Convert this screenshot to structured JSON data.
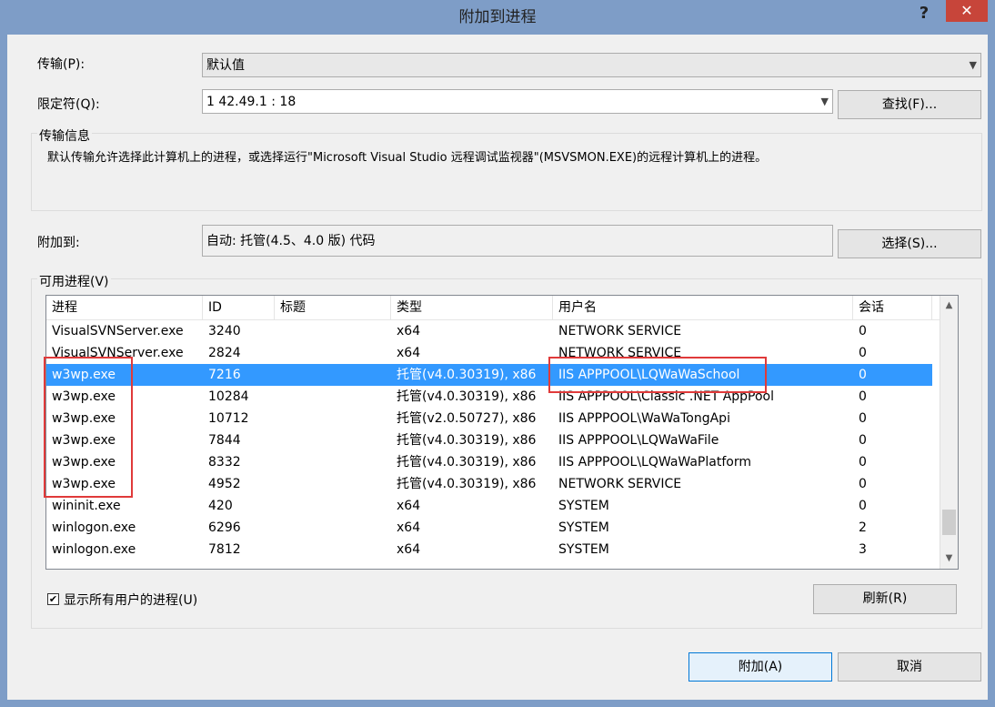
{
  "window": {
    "title": "附加到进程",
    "help_glyph": "?",
    "close_glyph": "✕"
  },
  "transport": {
    "label": "传输(P):",
    "value": "默认值"
  },
  "qualifier": {
    "label": "限定符(Q):",
    "value": "1  42.49.1 : 18",
    "find_button": "查找(F)..."
  },
  "transport_info": {
    "title": "传输信息",
    "text": "默认传输允许选择此计算机上的进程，或选择运行\"Microsoft Visual Studio 远程调试监视器\"(MSVSMON.EXE)的远程计算机上的进程。"
  },
  "attach_to": {
    "label": "附加到:",
    "value": "自动: 托管(4.5、4.0 版) 代码",
    "select_button": "选择(S)..."
  },
  "processes": {
    "group_title": "可用进程(V)",
    "columns": [
      "进程",
      "ID",
      "标题",
      "类型",
      "用户名",
      "会话"
    ],
    "rows": [
      {
        "name": "VisualSVNServer.exe",
        "id": "3240",
        "title": "",
        "type": "x64",
        "user": "NETWORK SERVICE",
        "session": "0"
      },
      {
        "name": "VisualSVNServer.exe",
        "id": "2824",
        "title": "",
        "type": "x64",
        "user": "NETWORK SERVICE",
        "session": "0"
      },
      {
        "name": "w3wp.exe",
        "id": "7216",
        "title": "",
        "type": "托管(v4.0.30319), x86",
        "user": "IIS APPPOOL\\LQWaWaSchool",
        "session": "0"
      },
      {
        "name": "w3wp.exe",
        "id": "10284",
        "title": "",
        "type": "托管(v4.0.30319), x86",
        "user": "IIS APPPOOL\\Classic .NET AppPool",
        "session": "0"
      },
      {
        "name": "w3wp.exe",
        "id": "10712",
        "title": "",
        "type": "托管(v2.0.50727), x86",
        "user": "IIS APPPOOL\\WaWaTongApi",
        "session": "0"
      },
      {
        "name": "w3wp.exe",
        "id": "7844",
        "title": "",
        "type": "托管(v4.0.30319), x86",
        "user": "IIS APPPOOL\\LQWaWaFile",
        "session": "0"
      },
      {
        "name": "w3wp.exe",
        "id": "8332",
        "title": "",
        "type": "托管(v4.0.30319), x86",
        "user": "IIS APPPOOL\\LQWaWaPlatform",
        "session": "0"
      },
      {
        "name": "w3wp.exe",
        "id": "4952",
        "title": "",
        "type": "托管(v4.0.30319), x86",
        "user": "NETWORK SERVICE",
        "session": "0"
      },
      {
        "name": "wininit.exe",
        "id": "420",
        "title": "",
        "type": "x64",
        "user": "SYSTEM",
        "session": "0"
      },
      {
        "name": "winlogon.exe",
        "id": "6296",
        "title": "",
        "type": "x64",
        "user": "SYSTEM",
        "session": "2"
      },
      {
        "name": "winlogon.exe",
        "id": "7812",
        "title": "",
        "type": "x64",
        "user": "SYSTEM",
        "session": "3"
      }
    ],
    "selected_row": 2,
    "show_all_users_label": "显示所有用户的进程(U)",
    "show_all_users_checked": true,
    "refresh_button": "刷新(R)"
  },
  "footer": {
    "attach_button": "附加(A)",
    "cancel_button": "取消"
  },
  "colors": {
    "selection": "#3399ff",
    "highlight_box": "#e03a3a",
    "close_button": "#c7453a"
  }
}
